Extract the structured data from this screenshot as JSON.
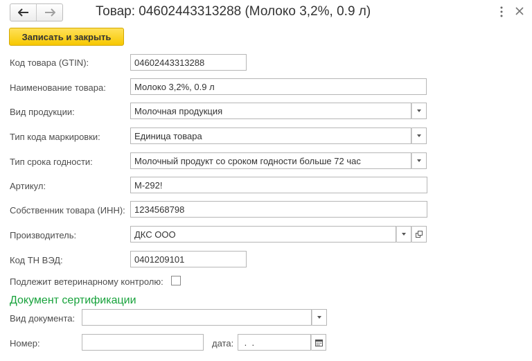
{
  "header": {
    "title": "Товар: 04602443313288 (Молоко 3,2%, 0.9 л)",
    "back_icon": "arrow-left",
    "forward_icon": "arrow-right",
    "more_icon": "vertical-dots",
    "close_icon": "close-x"
  },
  "toolbar": {
    "save_close_label": "Записать и закрыть",
    "save_close_color": "#f7c800"
  },
  "form": {
    "gtin": {
      "label": "Код товара (GTIN):",
      "value": "04602443313288"
    },
    "name": {
      "label": "Наименование товара:",
      "value": "Молоко 3,2%, 0.9 л"
    },
    "product_type": {
      "label": "Вид продукции:",
      "value": "Молочная продукция"
    },
    "marking_code_type": {
      "label": "Тип кода маркировки:",
      "value": "Единица товара"
    },
    "shelf_life_type": {
      "label": "Тип срока годности:",
      "value": "Молочный продукт со сроком годности больше 72 час"
    },
    "article": {
      "label": "Артикул:",
      "value": "М-292!"
    },
    "owner_inn": {
      "label": "Собственник товара (ИНН):",
      "value": "1234568798"
    },
    "manufacturer": {
      "label": "Производитель:",
      "value": "ДКС ООО"
    },
    "tnved": {
      "label": "Код ТН ВЭД:",
      "value": "0401209101"
    },
    "vet_control": {
      "label": "Подлежит ветеринарному контролю:",
      "checked": false
    }
  },
  "certification": {
    "section_title": "Документ сертификации",
    "section_color": "#17a23b",
    "doc_type": {
      "label": "Вид документа:",
      "value": ""
    },
    "number": {
      "label": "Номер:",
      "value": ""
    },
    "date": {
      "label": "дата:",
      "value": " .  . "
    }
  }
}
